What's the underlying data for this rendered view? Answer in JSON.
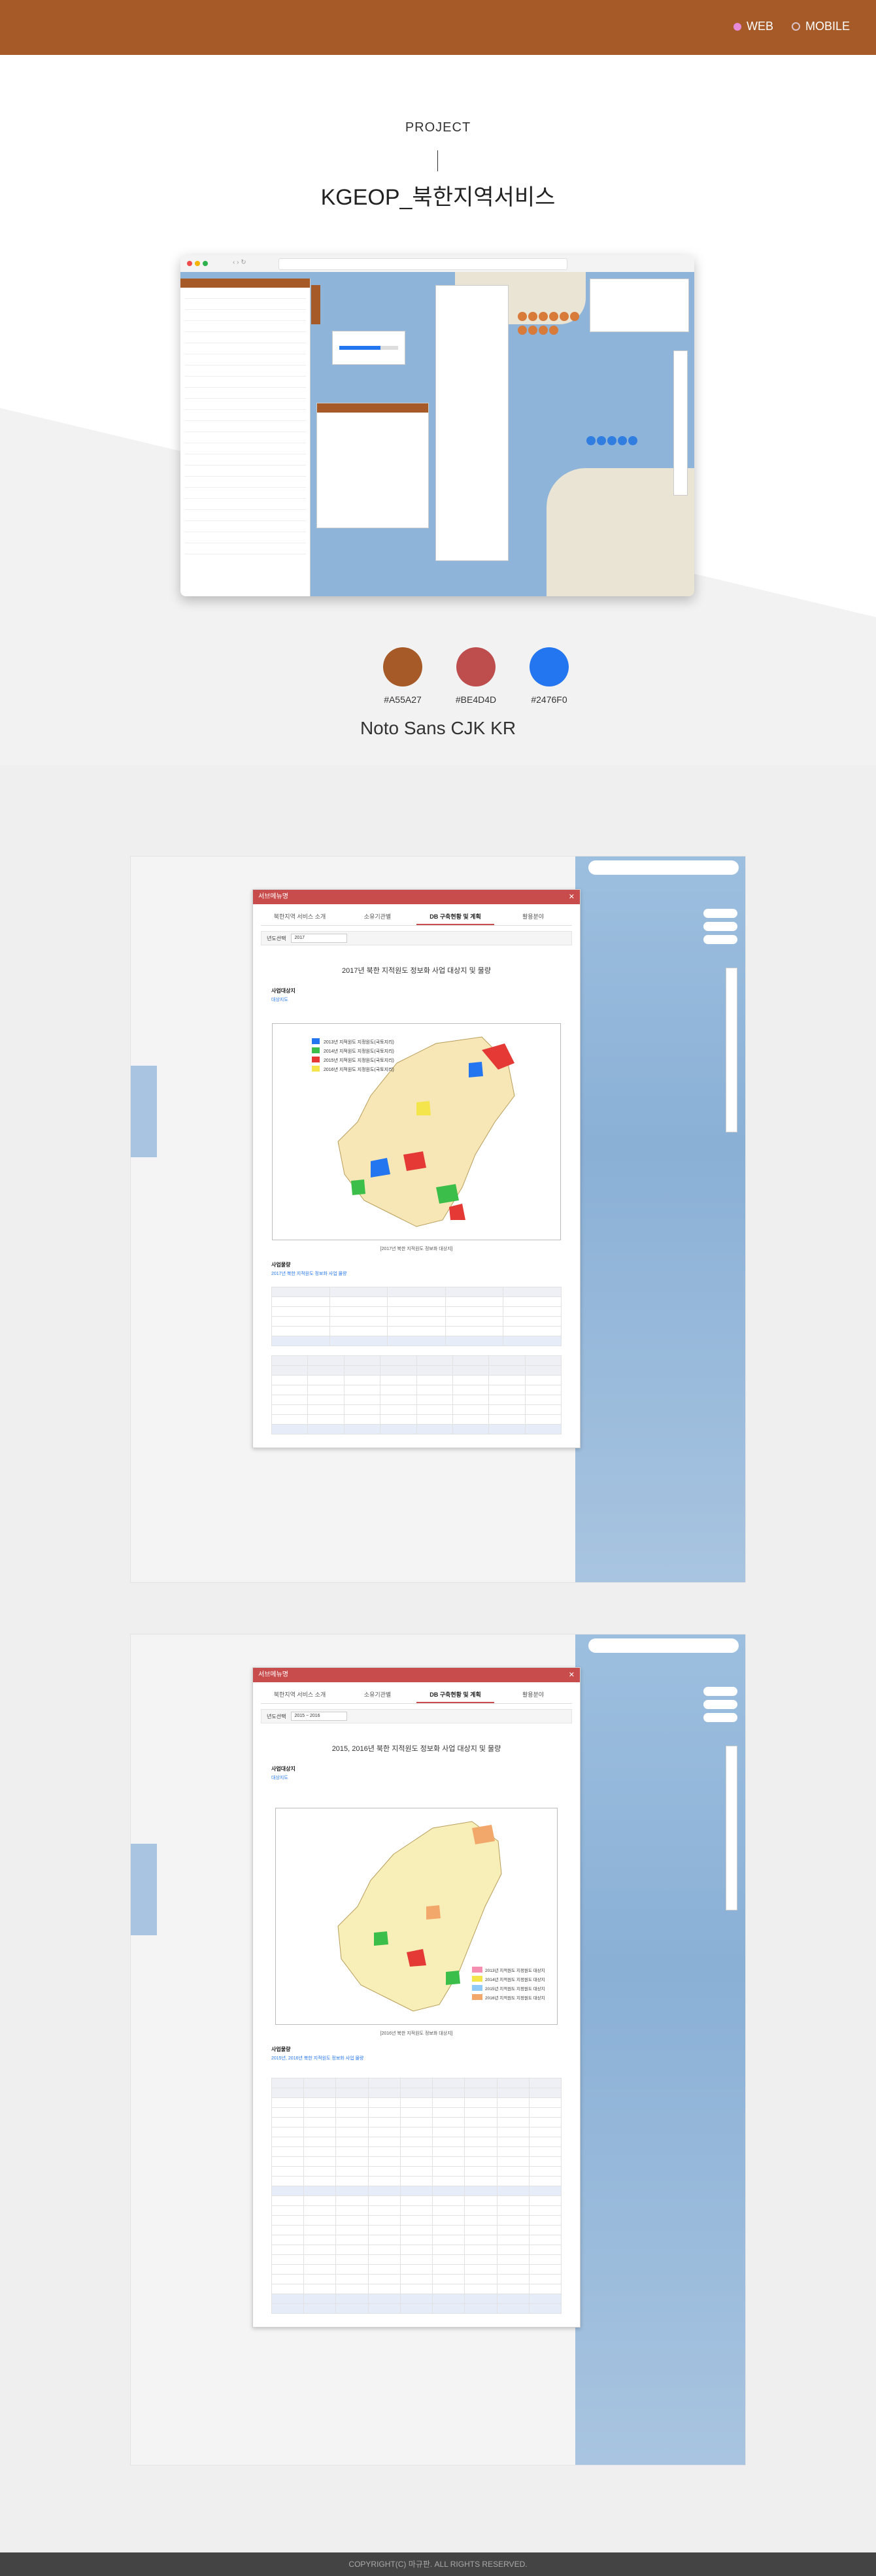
{
  "nav": {
    "web": "WEB",
    "mobile": "MOBILE"
  },
  "hero": {
    "label": "PROJECT",
    "title": "KGEOP_북한지역서비스"
  },
  "palette": [
    {
      "hex": "#A55A27",
      "label": "#A55A27"
    },
    {
      "hex": "#BE4D4D",
      "label": "#BE4D4D"
    },
    {
      "hex": "#2476F0",
      "label": "#2476F0"
    }
  ],
  "font_name": "Noto Sans CJK KR",
  "screen1": {
    "window_title": "서브메뉴명",
    "tabs": [
      "북한지역 서비스 소개",
      "소유기관별",
      "DB 구축현황 및 계획",
      "활용분야"
    ],
    "filter_label": "년도선택",
    "filter_value": "2017",
    "doc_title": "2017년 북한 지적원도 정보화 사업 대상지 및 물량",
    "section1": "사업대상지",
    "section1_sub": "대상지도",
    "map_caption": "[2017년 북한 지적원도 정보화 대상지]",
    "section2": "사업물량",
    "section2_sub": "2017년 북한 지적원도 정보화 사업 물량",
    "legend": [
      "2013년 지적원도 지정원도(국토지리)",
      "2014년 지적원도 지정원도(국토지리)",
      "2015년 지적원도 지정원도(국토지리)",
      "2016년 지적원도 지정원도(국토지리)"
    ]
  },
  "screen2": {
    "window_title": "서브메뉴명",
    "tabs": [
      "북한지역 서비스 소개",
      "소유기관별",
      "DB 구축현황 및 계획",
      "활용분야"
    ],
    "filter_label": "년도선택",
    "filter_value": "2015 ~ 2016",
    "doc_title": "2015, 2016년 북한 지적원도 정보화 사업 대상지 및 물량",
    "section1": "사업대상지",
    "section1_sub": "대상지도",
    "map_caption": "[2016년 북한 지적원도 정보화 대상지]",
    "section2": "사업물량",
    "section2_sub": "2015년, 2016년 북한 지적원도 정보화 사업 물량",
    "legend": [
      "2013년 지적원도 지정원도 대상지",
      "2014년 지적원도 지정원도 대상지",
      "2015년 지적원도 지정원도 대상지",
      "2016년 지적원도 지정원도 대상지"
    ]
  },
  "footer": "COPYRIGHT(C) 마규판. ALL RIGHTS RESERVED."
}
